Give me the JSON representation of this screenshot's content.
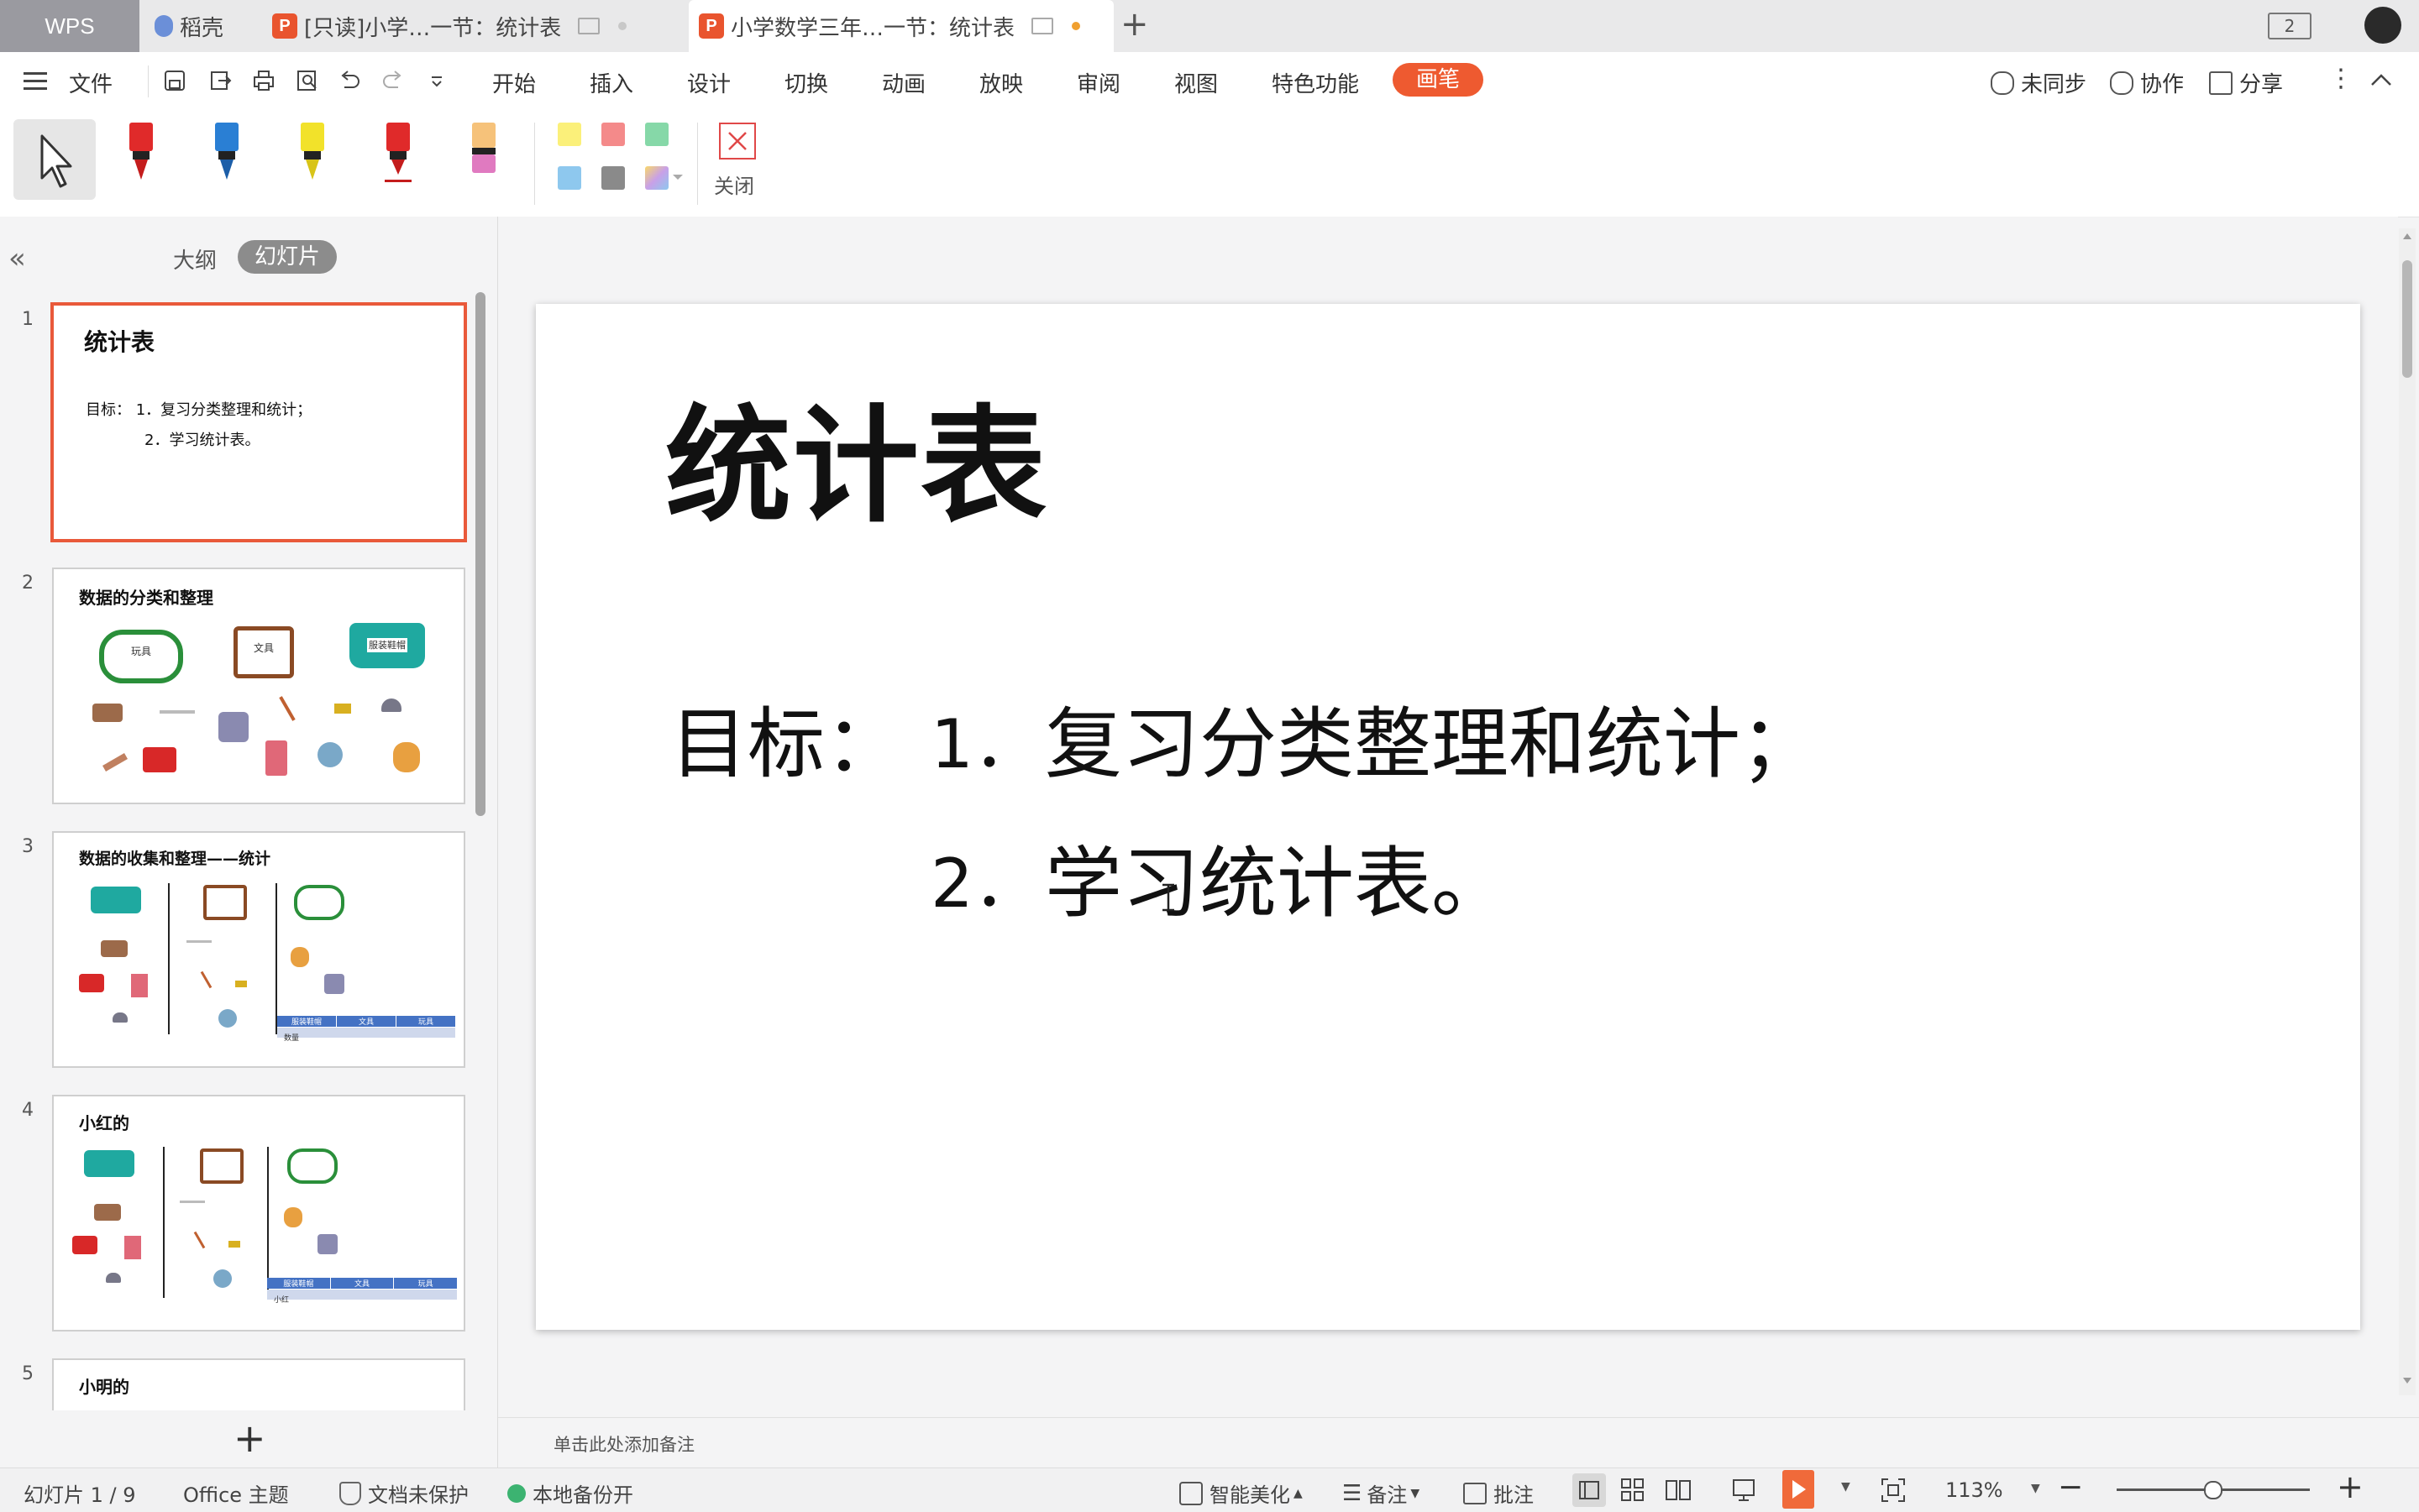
{
  "tabs": {
    "wps": "WPS",
    "daoke": "稻壳",
    "doc1": "[只读]小学…一节：统计表",
    "doc2": "小学数学三年…一节：统计表",
    "doc2_modified_dot_color": "#f0a030",
    "window_count": "2"
  },
  "menu": {
    "file": "文件",
    "items": [
      "开始",
      "插入",
      "设计",
      "切换",
      "动画",
      "放映",
      "审阅",
      "视图",
      "特色功能"
    ],
    "active": "画笔",
    "sync": "未同步",
    "collab": "协作",
    "share": "分享"
  },
  "pen_toolbar": {
    "pen_colors": [
      "#e02a2a",
      "#2a7fd4",
      "#f2e22a",
      "#e02a2a",
      "#f6a860"
    ],
    "swatches": [
      "#fbf07a",
      "#f48a8a",
      "#86d8a8",
      "#8ec8ee",
      "#8a8a8a",
      "#c8a0e8"
    ],
    "close_label": "关闭"
  },
  "left_panel": {
    "outline_label": "大纲",
    "slides_label": "幻灯片",
    "thumbnails": [
      {
        "number": "1",
        "title": "统计表",
        "line1": "目标：  1．复习分类整理和统计；",
        "line2": "2．学习统计表。"
      },
      {
        "number": "2",
        "title": "数据的分类和整理",
        "labels": [
          "玩具",
          "文具",
          "服装鞋帽"
        ]
      },
      {
        "number": "3",
        "title": "数据的收集和整理——统计",
        "table_headers": [
          "服装鞋帽",
          "文具",
          "玩具"
        ],
        "row_label": "数量"
      },
      {
        "number": "4",
        "title": "小红的",
        "table_headers": [
          "服装鞋帽",
          "文具",
          "玩具"
        ],
        "row_label": "小红"
      },
      {
        "number": "5",
        "title": "小明的"
      }
    ]
  },
  "slide": {
    "title": "统计表",
    "goal_label": "目标：",
    "goal1_num": "1．",
    "goal1_text": "复习分类整理和统计；",
    "goal2_num": "2．",
    "goal2_text": "学习统计表。"
  },
  "notes_placeholder": "单击此处添加备注",
  "status": {
    "slide_counter": "幻灯片 1 / 9",
    "theme": "Office 主题",
    "protect": "文档未保护",
    "backup": "本地备份开",
    "beautify": "智能美化",
    "notes": "备注",
    "comment": "批注",
    "zoom": "113%",
    "zoom_fraction": 0.5
  }
}
